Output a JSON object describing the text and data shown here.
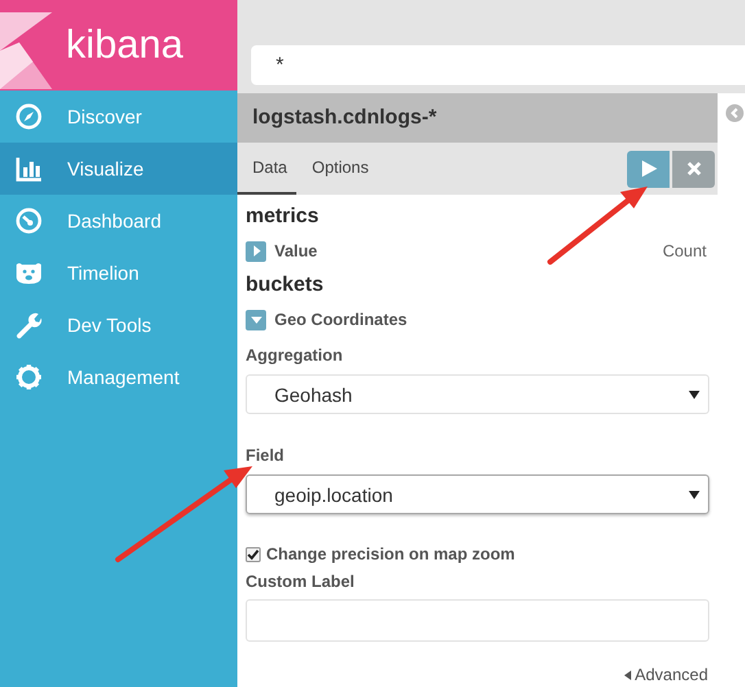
{
  "sidebar": {
    "logo": "kibana",
    "items": [
      {
        "label": "Discover",
        "selected": false
      },
      {
        "label": "Visualize",
        "selected": true
      },
      {
        "label": "Dashboard",
        "selected": false
      },
      {
        "label": "Timelion",
        "selected": false
      },
      {
        "label": "Dev Tools",
        "selected": false
      },
      {
        "label": "Management",
        "selected": false
      }
    ]
  },
  "query": {
    "value": "*"
  },
  "index_pattern": "logstash.cdnlogs-*",
  "tabs": [
    {
      "label": "Data",
      "selected": true
    },
    {
      "label": "Options",
      "selected": false
    }
  ],
  "metrics": {
    "title": "metrics",
    "items": [
      {
        "label": "Value",
        "expanded": false,
        "summary": "Count"
      }
    ]
  },
  "buckets": {
    "title": "buckets",
    "items": [
      {
        "label": "Geo Coordinates",
        "expanded": true
      }
    ]
  },
  "aggregation": {
    "label": "Aggregation",
    "value": "Geohash",
    "focused": false
  },
  "field": {
    "label": "Field",
    "value": "geoip.location",
    "focused": true
  },
  "precision": {
    "label": "Change precision on map zoom",
    "checked": true
  },
  "custom_label": {
    "label": "Custom Label"
  },
  "advanced": {
    "label": "Advanced",
    "expanded": false
  }
}
